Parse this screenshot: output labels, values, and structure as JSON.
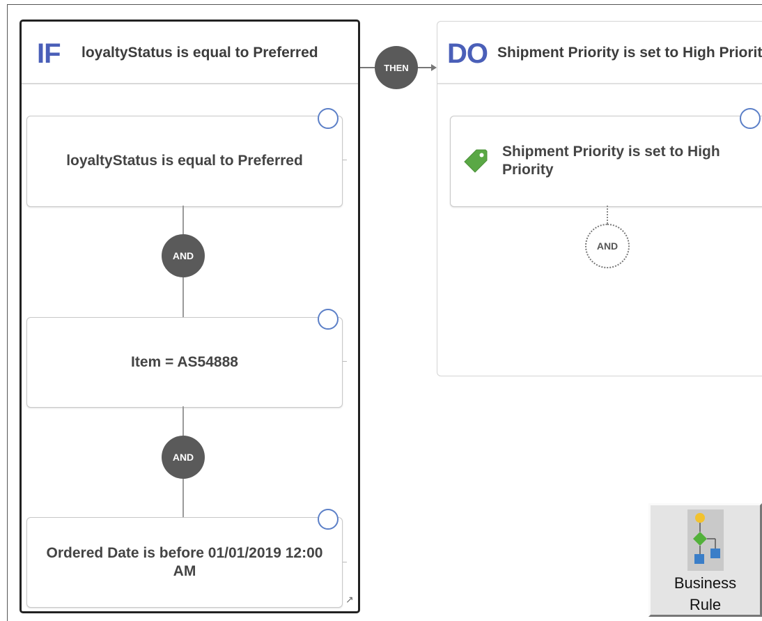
{
  "if_panel": {
    "keyword": "IF",
    "header_text": "loyaltyStatus is equal to Preferred",
    "conditions": [
      {
        "text": "loyaltyStatus is equal to Preferred"
      },
      {
        "text": "Item = AS54888"
      },
      {
        "text": "Ordered Date is before 01/01/2019 12:00 AM"
      }
    ],
    "connectors": [
      "AND",
      "AND"
    ]
  },
  "then_label": "THEN",
  "do_panel": {
    "keyword": "DO",
    "header_text": "Shipment Priority is set to High Priority",
    "actions": [
      {
        "text": "Shipment Priority is set to High Priority",
        "icon": "tag-icon",
        "icon_color": "#5aa845"
      }
    ],
    "add_connector": "AND"
  },
  "business_rule_button": {
    "label_line1": "Business",
    "label_line2": "Rule",
    "icon": "flowchart-icon"
  },
  "colors": {
    "keyword": "#4a5fb8",
    "node": "#5a5a5a",
    "card_dot": "#5b7fc7"
  }
}
